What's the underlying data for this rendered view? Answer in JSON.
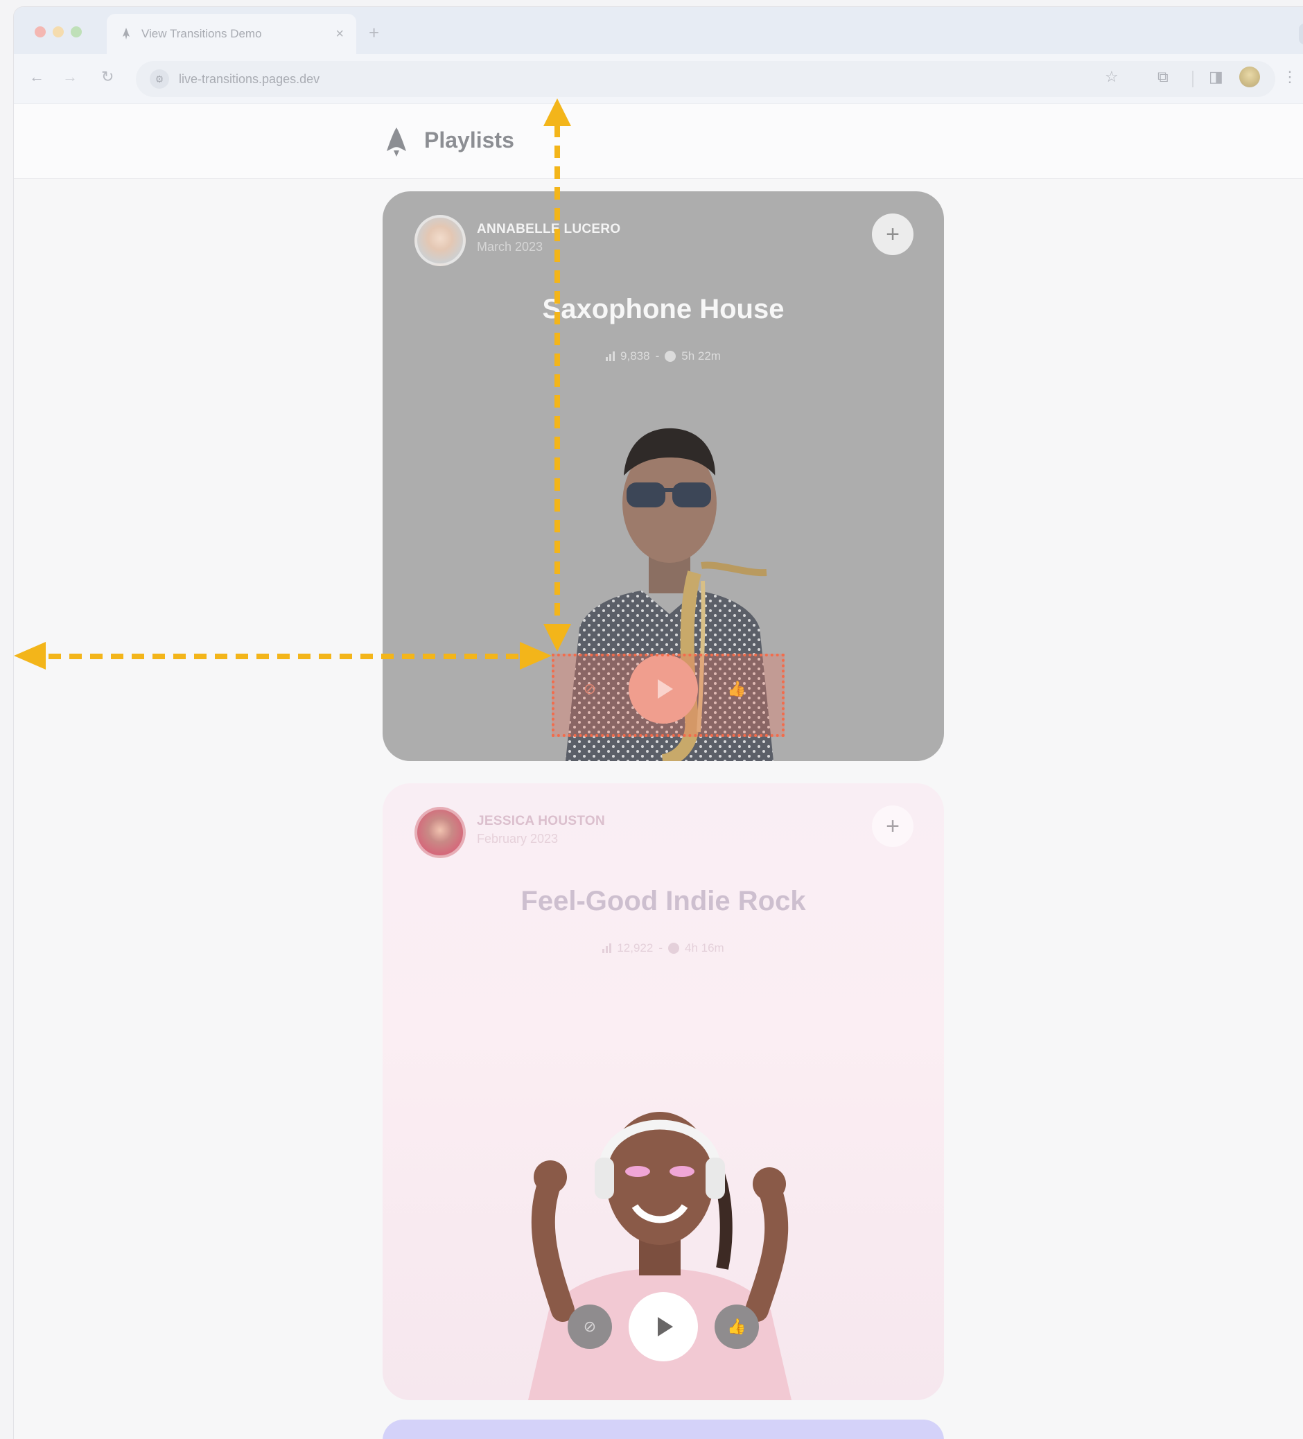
{
  "browser": {
    "tab_title": "View Transitions Demo",
    "close_glyph": "×",
    "new_tab_glyph": "+",
    "tab_menu_glyph": "⌄",
    "url": "live-transitions.pages.dev",
    "icons": [
      "back-icon",
      "forward-icon",
      "reload-icon",
      "site-info-icon",
      "star-icon",
      "extensions-icon",
      "side-panel-icon",
      "profile-icon",
      "menu-icon"
    ],
    "glyphs": {
      "back": "←",
      "forward": "→",
      "reload": "↻",
      "site_info": "⚙",
      "star": "☆",
      "extensions": "⧉",
      "side_panel": "◨",
      "menu": "⋮"
    }
  },
  "site": {
    "title": "Playlists",
    "logo": "rocket-logo-icon"
  },
  "cards": [
    {
      "author": "ANNABELLE LUCERO",
      "date": "March 2023",
      "title": "Saxophone House",
      "plays": "9,838",
      "separator": "-",
      "duration": "5h 22m",
      "add": "+",
      "block": "⊘",
      "like": "👍",
      "background": "#adadad"
    },
    {
      "author": "JESSICA HOUSTON",
      "date": "February 2023",
      "title": "Feel-Good Indie Rock",
      "plays": "12,922",
      "separator": "-",
      "duration": "4h 16m",
      "add": "+",
      "block": "⊘",
      "like": "👍",
      "background": "#f9eef4"
    }
  ],
  "annotation": {
    "highlight_color": "#f26c4b",
    "arrow_color": "#f3b51a"
  }
}
